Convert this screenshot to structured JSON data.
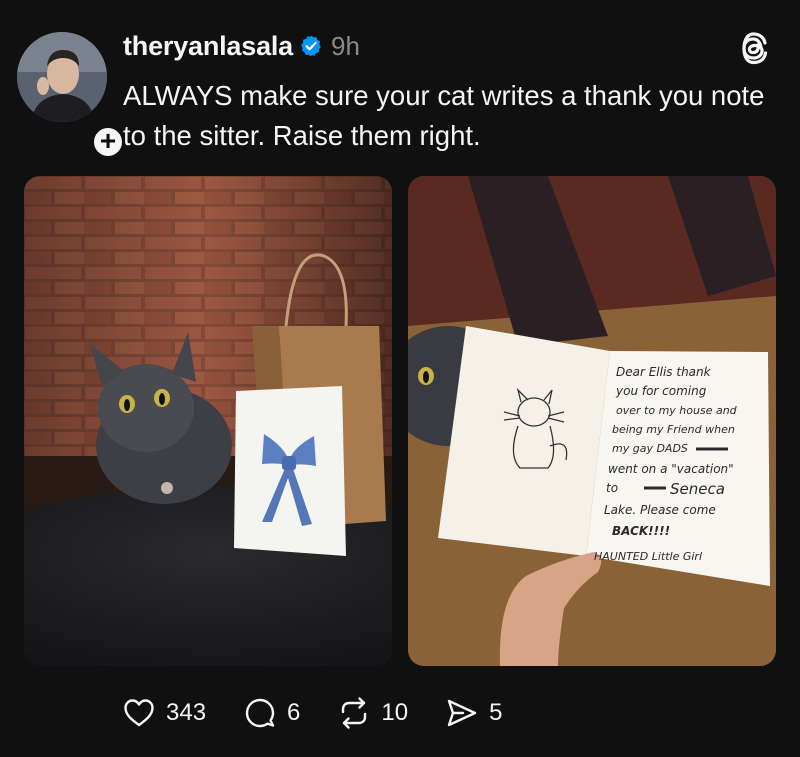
{
  "post": {
    "username": "theryanlasala",
    "timestamp": "9h",
    "text": "ALWAYS make sure your cat writes a thank you note to the sitter. Raise them right."
  },
  "card_text": {
    "line1": "Dear Ellis thank",
    "line2": "you for coming",
    "line3": "over to my house and",
    "line4": "being my Friend when",
    "line5": "my gay DADS",
    "line6": "went on a \"vacation\"",
    "line7": "to",
    "line8": "Seneca",
    "line9": "Lake. Please come",
    "line10": "BACK!!!!",
    "line11": "HAUNTED Little Girl"
  },
  "actions": {
    "likes": "343",
    "replies": "6",
    "reposts": "10",
    "shares": "5"
  },
  "icons": {
    "like": "heart-icon",
    "reply": "comment-icon",
    "repost": "repost-icon",
    "share": "send-icon",
    "verified": "verified-badge-icon",
    "app": "threads-logo-icon"
  },
  "colors": {
    "background": "#101010",
    "text": "#f3f5f7",
    "muted": "#8a8a8a",
    "verified": "#0095f6"
  }
}
